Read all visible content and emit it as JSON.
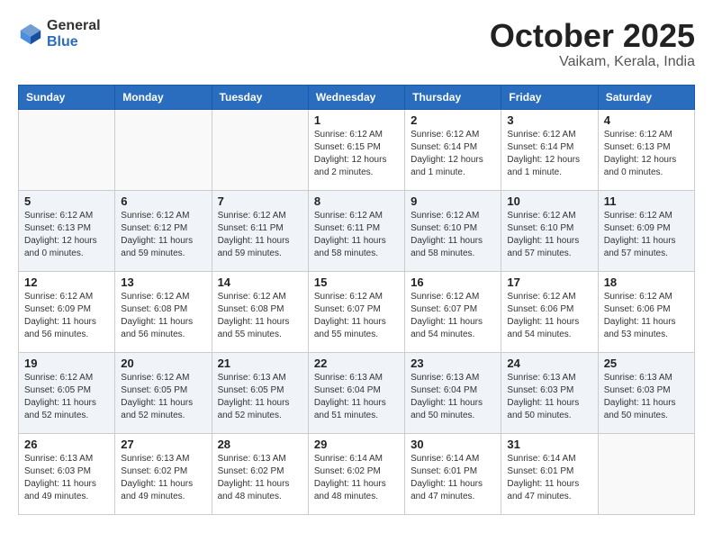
{
  "logo": {
    "general": "General",
    "blue": "Blue"
  },
  "title": {
    "month": "October 2025",
    "location": "Vaikam, Kerala, India"
  },
  "headers": [
    "Sunday",
    "Monday",
    "Tuesday",
    "Wednesday",
    "Thursday",
    "Friday",
    "Saturday"
  ],
  "weeks": [
    [
      {
        "day": "",
        "info": ""
      },
      {
        "day": "",
        "info": ""
      },
      {
        "day": "",
        "info": ""
      },
      {
        "day": "1",
        "info": "Sunrise: 6:12 AM\nSunset: 6:15 PM\nDaylight: 12 hours\nand 2 minutes."
      },
      {
        "day": "2",
        "info": "Sunrise: 6:12 AM\nSunset: 6:14 PM\nDaylight: 12 hours\nand 1 minute."
      },
      {
        "day": "3",
        "info": "Sunrise: 6:12 AM\nSunset: 6:14 PM\nDaylight: 12 hours\nand 1 minute."
      },
      {
        "day": "4",
        "info": "Sunrise: 6:12 AM\nSunset: 6:13 PM\nDaylight: 12 hours\nand 0 minutes."
      }
    ],
    [
      {
        "day": "5",
        "info": "Sunrise: 6:12 AM\nSunset: 6:13 PM\nDaylight: 12 hours\nand 0 minutes."
      },
      {
        "day": "6",
        "info": "Sunrise: 6:12 AM\nSunset: 6:12 PM\nDaylight: 11 hours\nand 59 minutes."
      },
      {
        "day": "7",
        "info": "Sunrise: 6:12 AM\nSunset: 6:11 PM\nDaylight: 11 hours\nand 59 minutes."
      },
      {
        "day": "8",
        "info": "Sunrise: 6:12 AM\nSunset: 6:11 PM\nDaylight: 11 hours\nand 58 minutes."
      },
      {
        "day": "9",
        "info": "Sunrise: 6:12 AM\nSunset: 6:10 PM\nDaylight: 11 hours\nand 58 minutes."
      },
      {
        "day": "10",
        "info": "Sunrise: 6:12 AM\nSunset: 6:10 PM\nDaylight: 11 hours\nand 57 minutes."
      },
      {
        "day": "11",
        "info": "Sunrise: 6:12 AM\nSunset: 6:09 PM\nDaylight: 11 hours\nand 57 minutes."
      }
    ],
    [
      {
        "day": "12",
        "info": "Sunrise: 6:12 AM\nSunset: 6:09 PM\nDaylight: 11 hours\nand 56 minutes."
      },
      {
        "day": "13",
        "info": "Sunrise: 6:12 AM\nSunset: 6:08 PM\nDaylight: 11 hours\nand 56 minutes."
      },
      {
        "day": "14",
        "info": "Sunrise: 6:12 AM\nSunset: 6:08 PM\nDaylight: 11 hours\nand 55 minutes."
      },
      {
        "day": "15",
        "info": "Sunrise: 6:12 AM\nSunset: 6:07 PM\nDaylight: 11 hours\nand 55 minutes."
      },
      {
        "day": "16",
        "info": "Sunrise: 6:12 AM\nSunset: 6:07 PM\nDaylight: 11 hours\nand 54 minutes."
      },
      {
        "day": "17",
        "info": "Sunrise: 6:12 AM\nSunset: 6:06 PM\nDaylight: 11 hours\nand 54 minutes."
      },
      {
        "day": "18",
        "info": "Sunrise: 6:12 AM\nSunset: 6:06 PM\nDaylight: 11 hours\nand 53 minutes."
      }
    ],
    [
      {
        "day": "19",
        "info": "Sunrise: 6:12 AM\nSunset: 6:05 PM\nDaylight: 11 hours\nand 52 minutes."
      },
      {
        "day": "20",
        "info": "Sunrise: 6:12 AM\nSunset: 6:05 PM\nDaylight: 11 hours\nand 52 minutes."
      },
      {
        "day": "21",
        "info": "Sunrise: 6:13 AM\nSunset: 6:05 PM\nDaylight: 11 hours\nand 52 minutes."
      },
      {
        "day": "22",
        "info": "Sunrise: 6:13 AM\nSunset: 6:04 PM\nDaylight: 11 hours\nand 51 minutes."
      },
      {
        "day": "23",
        "info": "Sunrise: 6:13 AM\nSunset: 6:04 PM\nDaylight: 11 hours\nand 50 minutes."
      },
      {
        "day": "24",
        "info": "Sunrise: 6:13 AM\nSunset: 6:03 PM\nDaylight: 11 hours\nand 50 minutes."
      },
      {
        "day": "25",
        "info": "Sunrise: 6:13 AM\nSunset: 6:03 PM\nDaylight: 11 hours\nand 50 minutes."
      }
    ],
    [
      {
        "day": "26",
        "info": "Sunrise: 6:13 AM\nSunset: 6:03 PM\nDaylight: 11 hours\nand 49 minutes."
      },
      {
        "day": "27",
        "info": "Sunrise: 6:13 AM\nSunset: 6:02 PM\nDaylight: 11 hours\nand 49 minutes."
      },
      {
        "day": "28",
        "info": "Sunrise: 6:13 AM\nSunset: 6:02 PM\nDaylight: 11 hours\nand 48 minutes."
      },
      {
        "day": "29",
        "info": "Sunrise: 6:14 AM\nSunset: 6:02 PM\nDaylight: 11 hours\nand 48 minutes."
      },
      {
        "day": "30",
        "info": "Sunrise: 6:14 AM\nSunset: 6:01 PM\nDaylight: 11 hours\nand 47 minutes."
      },
      {
        "day": "31",
        "info": "Sunrise: 6:14 AM\nSunset: 6:01 PM\nDaylight: 11 hours\nand 47 minutes."
      },
      {
        "day": "",
        "info": ""
      }
    ]
  ]
}
